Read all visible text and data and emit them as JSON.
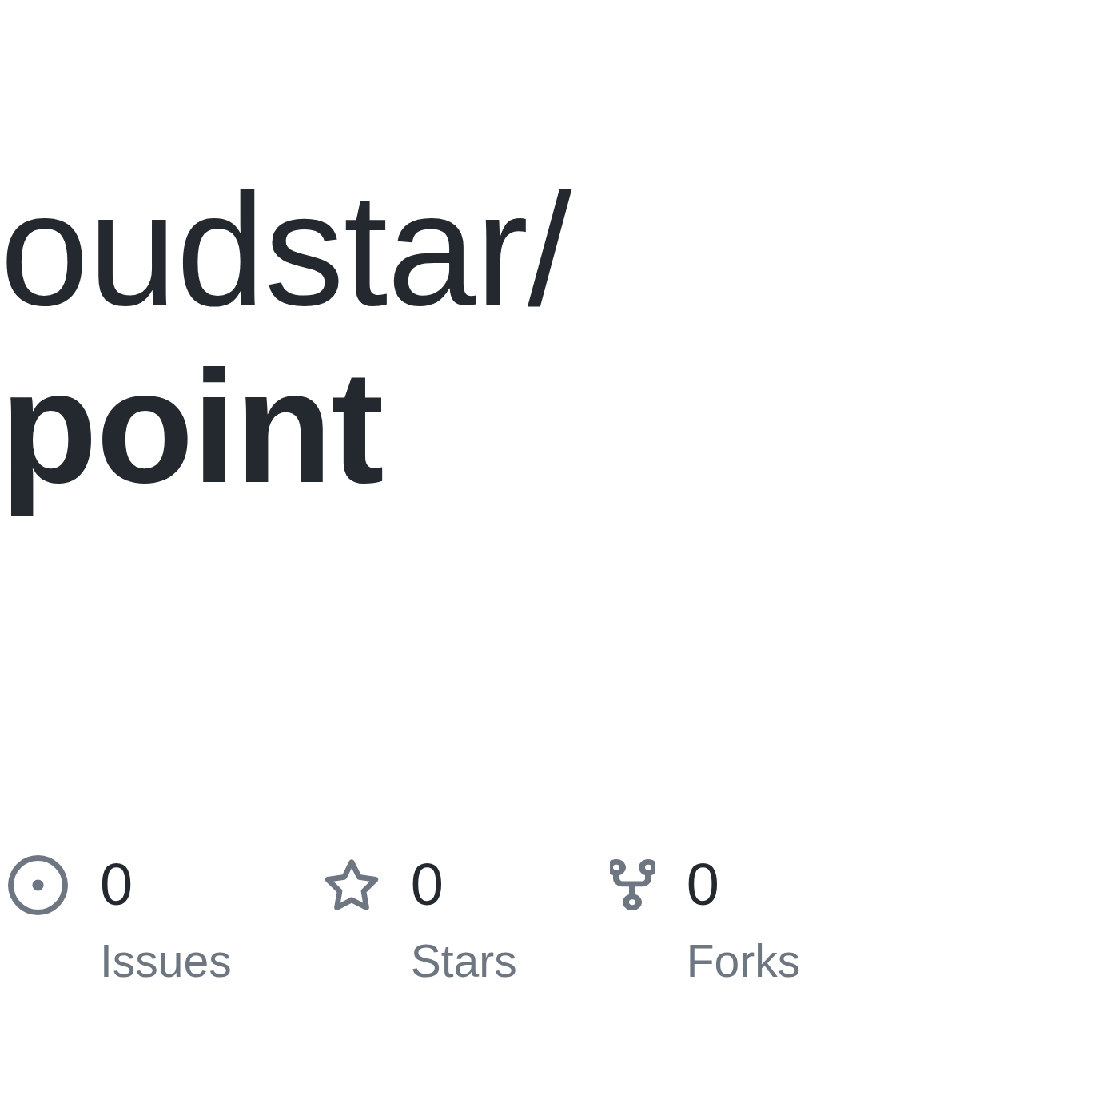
{
  "repository": {
    "owner": "oudstar/",
    "name": "point"
  },
  "stats": [
    {
      "kind": "issues",
      "count": "0",
      "label": "Issues"
    },
    {
      "kind": "stars",
      "count": "0",
      "label": "Stars"
    },
    {
      "kind": "forks",
      "count": "0",
      "label": "Forks"
    }
  ]
}
